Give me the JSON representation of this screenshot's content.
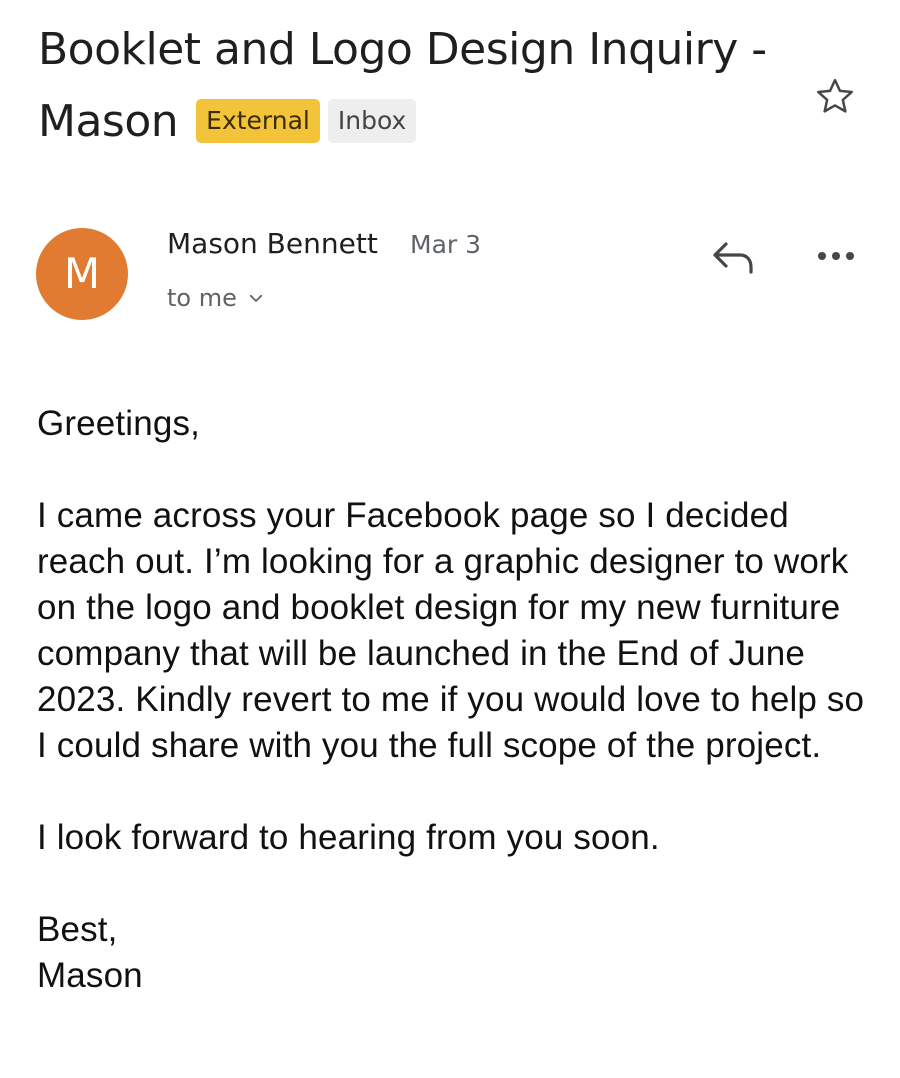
{
  "email": {
    "subject": "Booklet and Logo Design Inquiry - Mason",
    "labels": [
      "External",
      "Inbox"
    ],
    "sender": {
      "name": "Mason Bennett",
      "initial": "M",
      "avatar_color": "#e17b31"
    },
    "date": "Mar 3",
    "recipients": "to me",
    "body": {
      "greeting": "Greetings,",
      "paragraph": "I came across your Facebook page so I decided reach out. I’m looking for a graphic designer to work on the logo and booklet design for my new furniture company that will be launched in the End of June 2023. Kindly revert to me if you would love to help so I could share with you the full scope of the project.",
      "closing_line": "I look forward to hearing from you soon.",
      "signoff": "Best,",
      "signature": "Mason"
    }
  },
  "icons": {
    "star": "star-outline-icon",
    "reply": "reply-icon",
    "more": "more-horizontal-icon",
    "chevron": "chevron-down-icon"
  },
  "colors": {
    "external_label": "#f3c43a",
    "inbox_label": "#eeeeee",
    "secondary_text": "#5f6368"
  }
}
